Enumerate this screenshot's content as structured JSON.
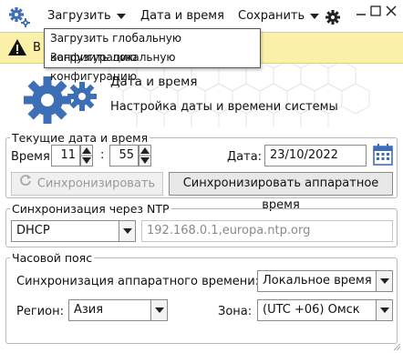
{
  "menu": {
    "load_label": "Загрузить",
    "datetime_label": "Дата и время",
    "save_label": "Сохранить"
  },
  "dropdown": {
    "items": [
      "Загрузить глобальную конфигурацию",
      "Загрузить локальную конфигурацию"
    ]
  },
  "warning": {
    "text": "В"
  },
  "header": {
    "title": "Дата и время",
    "subtitle": "Настройка даты и времени системы"
  },
  "current": {
    "legend": "Текущие дата и время",
    "time_label": "Время:",
    "hours": "11",
    "minutes": "55",
    "date_label": "Дата:",
    "date": "23/10/2022",
    "sync_label": "Синхронизировать",
    "sync_hw_label": "Синхронизировать аппаратное время"
  },
  "ntp": {
    "legend": "Синхронизация через NTP",
    "mode": "DHCP",
    "servers_placeholder": "192.168.0.1,europa.ntp.org"
  },
  "tz": {
    "legend": "Часовой пояс",
    "hw_sync_label": "Синхронизация аппаратного времени:",
    "hw_sync_value": "Локальное время",
    "region_label": "Регион:",
    "region_value": "Азия",
    "zone_label": "Зона:",
    "zone_value": "(UTC +06) Омск"
  },
  "colors": {
    "accent_blue": "#3d6fb6",
    "warning_bg": "#fbf0a8"
  }
}
